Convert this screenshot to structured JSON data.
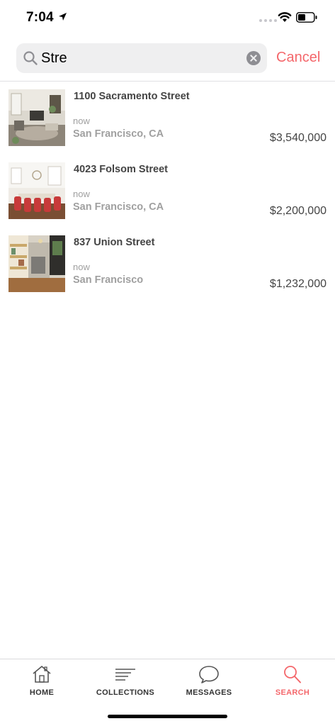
{
  "status_bar": {
    "time": "7:04"
  },
  "search": {
    "value": "Stre",
    "cancel_label": "Cancel"
  },
  "listings": [
    {
      "address": "1100 Sacramento Street",
      "time": "now",
      "city": "San Francisco, CA",
      "price": "$3,540,000"
    },
    {
      "address": "4023 Folsom Street",
      "time": "now",
      "city": "San Francisco, CA",
      "price": "$2,200,000"
    },
    {
      "address": "837 Union Street",
      "time": "now",
      "city": "San Francisco",
      "price": "$1,232,000"
    }
  ],
  "tabs": [
    {
      "label": "HOME",
      "icon": "house-icon"
    },
    {
      "label": "COLLECTIONS",
      "icon": "lines-icon"
    },
    {
      "label": "MESSAGES",
      "icon": "speech-bubble-icon"
    },
    {
      "label": "SEARCH",
      "icon": "search-icon",
      "active": true
    }
  ],
  "colors": {
    "accent": "#f4676b",
    "text": "#444444",
    "muted": "#a0a0a0"
  }
}
